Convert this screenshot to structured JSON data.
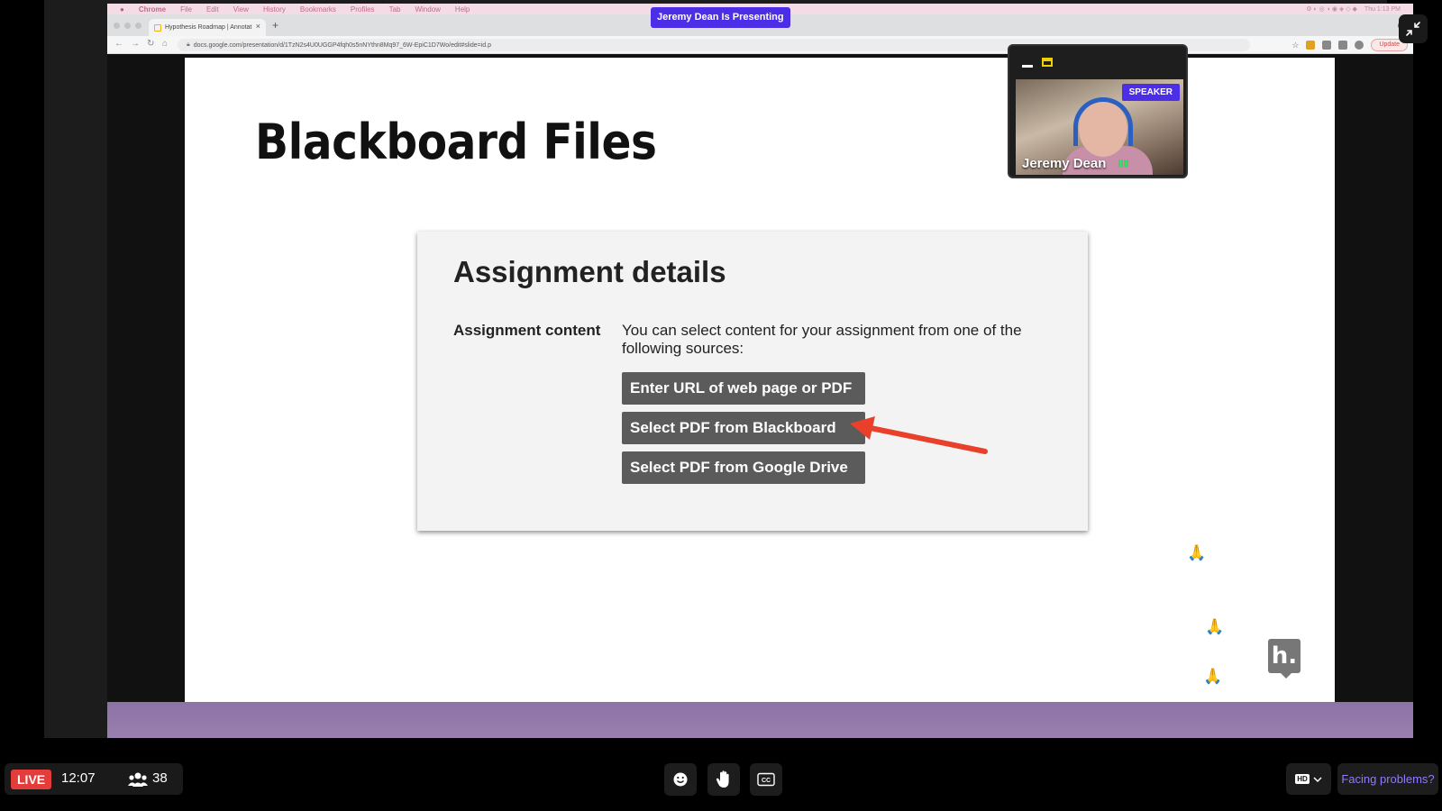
{
  "mac_menu": {
    "apple": "",
    "items": [
      "Chrome",
      "File",
      "Edit",
      "View",
      "History",
      "Bookmarks",
      "Profiles",
      "Tab",
      "Window",
      "Help"
    ],
    "clock": "Thu 1:13 PM"
  },
  "browser": {
    "tab_title": "Hypothesis Roadmap | Annotat",
    "tab_close": "×",
    "new_tab": "+",
    "url": "docs.google.com/presentation/d/1TzN2s4U0UGGP4fqh0s5nNYthn8Mq97_6W-EpiC1D7Wo/edit#slide=id.p",
    "update_label": "Update"
  },
  "presenting_banner": "Jeremy Dean Is Presenting",
  "slide": {
    "title": "Blackboard Files",
    "assignment": {
      "heading": "Assignment details",
      "label": "Assignment content",
      "description": "You can select content for your assignment from one of the following sources:",
      "buttons": [
        "Enter URL of web page or PDF",
        "Select PDF from Blackboard",
        "Select PDF from Google Drive"
      ]
    },
    "reactions": [
      "🙏",
      "🙏",
      "🙏"
    ],
    "hypothesis_logo": "h."
  },
  "speaker": {
    "badge": "SPEAKER",
    "name": "Jeremy Dean"
  },
  "controls": {
    "live_label": "LIVE",
    "elapsed": "12:07",
    "viewers": "38",
    "quality": "HD",
    "help_label": "Facing problems?"
  },
  "colors": {
    "live_red": "#e43b3b",
    "presenter_purple": "#4b2ee6",
    "arrow_red": "#e8402a",
    "link_purple": "#8e7cf6"
  },
  "icons": [
    "apple-icon",
    "back-icon",
    "forward-icon",
    "reload-icon",
    "home-icon",
    "lock-icon",
    "star-icon",
    "exit-fullscreen-icon",
    "viewers-icon",
    "emoji-icon",
    "raise-hand-icon",
    "closed-captions-icon",
    "chevron-down-icon"
  ]
}
